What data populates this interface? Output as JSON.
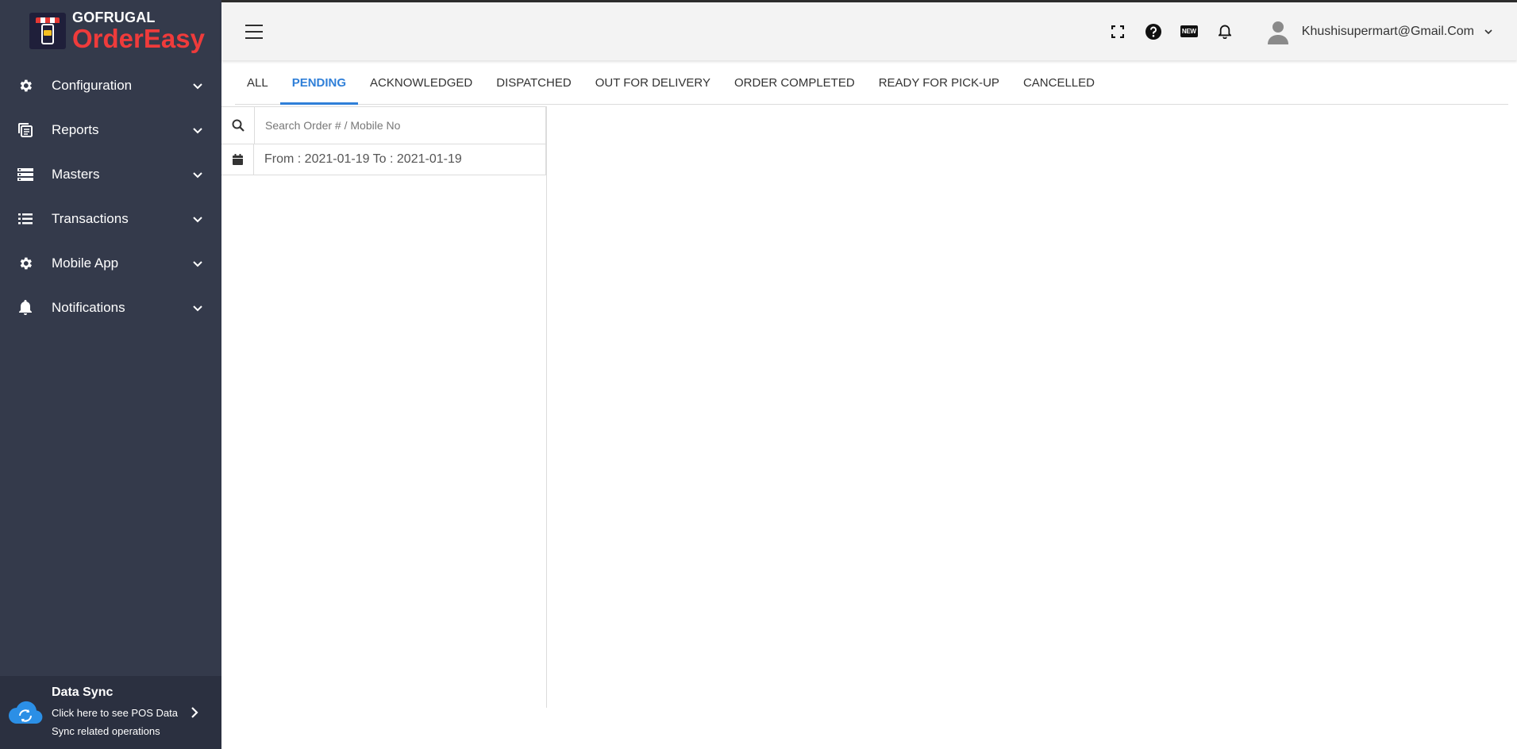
{
  "brand": {
    "name_top": "GOFRUGAL",
    "name_bottom": "OrderEasy",
    "accent_color": "#ef3b3b"
  },
  "sidebar": {
    "background": "#343a4b",
    "items": [
      {
        "label": "Configuration",
        "icon": "gear-icon"
      },
      {
        "label": "Reports",
        "icon": "report-icon"
      },
      {
        "label": "Masters",
        "icon": "server-icon"
      },
      {
        "label": "Transactions",
        "icon": "list-icon"
      },
      {
        "label": "Mobile App",
        "icon": "gear-icon"
      },
      {
        "label": "Notifications",
        "icon": "bell-icon"
      }
    ],
    "data_sync": {
      "title": "Data Sync",
      "description": "Click here to see POS Data Sync related operations",
      "icon": "cloud-sync-icon"
    }
  },
  "header": {
    "icons": [
      "fullscreen-icon",
      "help-icon",
      "new-badge-icon",
      "bell-icon"
    ],
    "new_badge_text": "NEW",
    "user_email": "Khushisupermart@Gmail.Com"
  },
  "tabs": [
    {
      "label": "ALL",
      "active": false
    },
    {
      "label": "PENDING",
      "active": true
    },
    {
      "label": "ACKNOWLEDGED",
      "active": false
    },
    {
      "label": "DISPATCHED",
      "active": false
    },
    {
      "label": "OUT FOR DELIVERY",
      "active": false
    },
    {
      "label": "ORDER COMPLETED",
      "active": false
    },
    {
      "label": "READY FOR PICK-UP",
      "active": false
    },
    {
      "label": "CANCELLED",
      "active": false
    }
  ],
  "active_tab_color": "#2f7fd8",
  "search": {
    "placeholder": "Search Order # / Mobile No",
    "value": ""
  },
  "date_range": {
    "text": "From : 2021-01-19 To : 2021-01-19"
  }
}
